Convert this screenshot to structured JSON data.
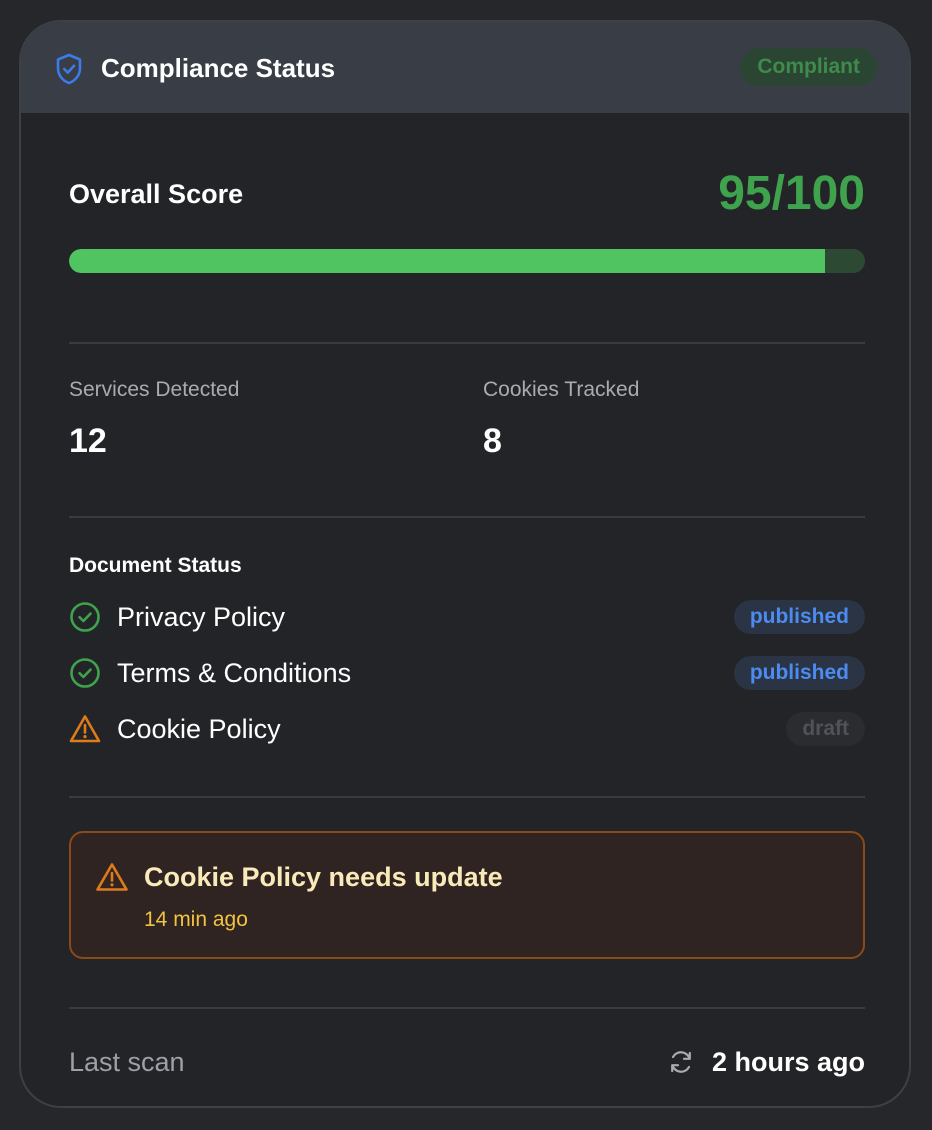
{
  "header": {
    "title": "Compliance Status",
    "status": "Compliant",
    "icon": "shield-check-icon"
  },
  "score": {
    "label": "Overall Score",
    "value_text": "95/100",
    "value": 95,
    "max": 100
  },
  "stats": [
    {
      "label": "Services Detected",
      "value": "12"
    },
    {
      "label": "Cookies Tracked",
      "value": "8"
    }
  ],
  "documents": {
    "title": "Document Status",
    "items": [
      {
        "name": "Privacy Policy",
        "status": "published",
        "icon": "check-circle-icon"
      },
      {
        "name": "Terms & Conditions",
        "status": "published",
        "icon": "check-circle-icon"
      },
      {
        "name": "Cookie Policy",
        "status": "draft",
        "icon": "warning-triangle-icon"
      }
    ]
  },
  "alert": {
    "title": "Cookie Policy needs update",
    "time": "14 min ago",
    "icon": "warning-triangle-icon"
  },
  "footer": {
    "label": "Last scan",
    "value": "2 hours ago",
    "icon": "refresh-icon"
  },
  "colors": {
    "background": "#26272b",
    "card": "#232427",
    "header": "#383d46",
    "success": "#3fa34d",
    "progress": "#4fc461",
    "accent_blue": "#4c8bf0",
    "warning": "#e07b1c",
    "alert_title": "#fbeab9",
    "alert_time": "#f0c341"
  }
}
